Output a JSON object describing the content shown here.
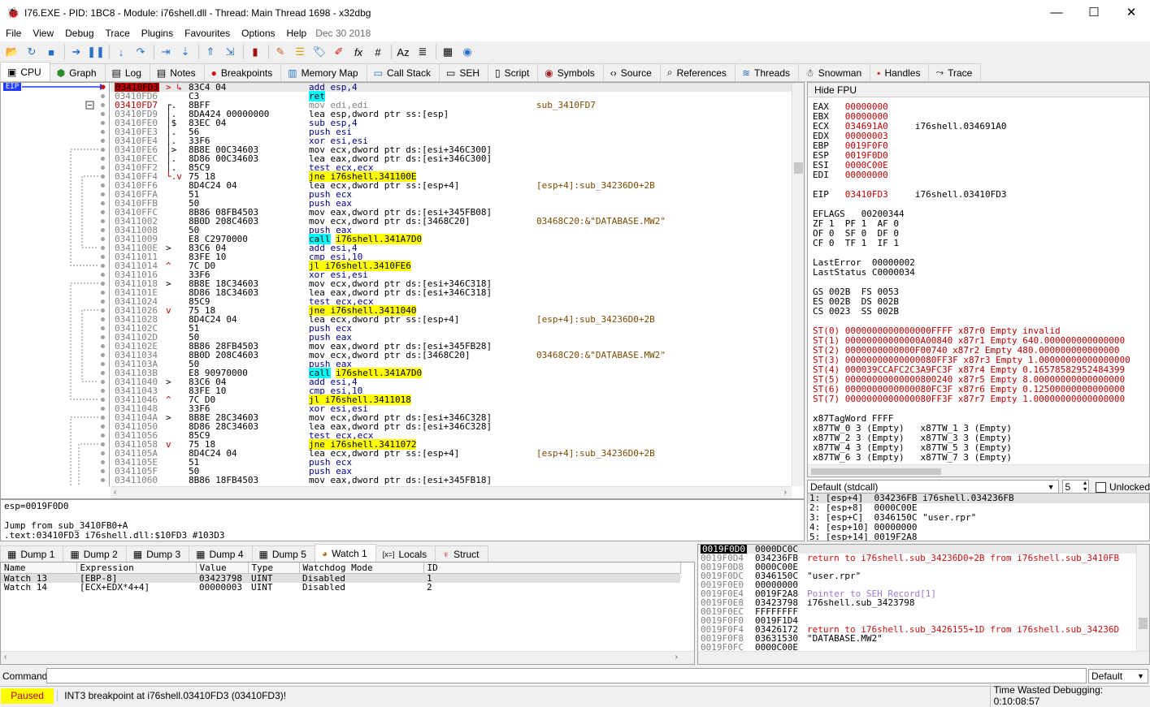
{
  "window": {
    "title": "I76.EXE - PID: 1BC8 - Module: i76shell.dll - Thread: Main Thread 1698 - x32dbg",
    "minimize": "—",
    "maximize": "☐",
    "close": "✕"
  },
  "menu": {
    "items": [
      "File",
      "View",
      "Debug",
      "Trace",
      "Plugins",
      "Favourites",
      "Options",
      "Help"
    ],
    "date": "Dec 30 2018"
  },
  "tabs": [
    "CPU",
    "Graph",
    "Log",
    "Notes",
    "Breakpoints",
    "Memory Map",
    "Call Stack",
    "SEH",
    "Script",
    "Symbols",
    "Source",
    "References",
    "Threads",
    "Snowman",
    "Handles",
    "Trace"
  ],
  "eip_label": "EIP",
  "disasm": [
    {
      "addr": "03410FD3",
      "flow": "> ↳",
      "bytes": "83C4 04",
      "ins": "add esp,4",
      "cmt": "",
      "eip": true
    },
    {
      "addr": "03410FD6",
      "flow": "",
      "bytes": "C3",
      "ins": "ret",
      "cmt": ""
    },
    {
      "addr": "03410FD7",
      "flow": "┌.",
      "bytes": "8BFF",
      "ins": "mov edi,edi",
      "cmt": "sub_3410FD7",
      "red": true
    },
    {
      "addr": "03410FD9",
      "flow": "│.",
      "bytes": "8DA424 00000000",
      "ins": "lea esp,dword ptr ss:[esp]",
      "cmt": ""
    },
    {
      "addr": "03410FE0",
      "flow": "│$",
      "bytes": "83EC 04",
      "ins": "sub esp,4",
      "cmt": ""
    },
    {
      "addr": "03410FE3",
      "flow": "│.",
      "bytes": "56",
      "ins": "push esi",
      "cmt": ""
    },
    {
      "addr": "03410FE4",
      "flow": "│.",
      "bytes": "33F6",
      "ins": "xor esi,esi",
      "cmt": ""
    },
    {
      "addr": "03410FE6",
      "flow": "│>",
      "bytes": "8B8E 00C34603",
      "ins": "mov ecx,dword ptr ds:[esi+346C300]",
      "cmt": ""
    },
    {
      "addr": "03410FEC",
      "flow": "│.",
      "bytes": "8D86 00C34603",
      "ins": "lea eax,dword ptr ds:[esi+346C300]",
      "cmt": ""
    },
    {
      "addr": "03410FF2",
      "flow": "│.",
      "bytes": "85C9",
      "ins": "test ecx,ecx",
      "cmt": ""
    },
    {
      "addr": "03410FF4",
      "flow": "└.v",
      "bytes": "75 18",
      "ins": "jne i76shell.341100E",
      "cmt": ""
    },
    {
      "addr": "03410FF6",
      "flow": "",
      "bytes": "8D4C24 04",
      "ins": "lea ecx,dword ptr ss:[esp+4]",
      "cmt": "[esp+4]:sub_34236D0+2B"
    },
    {
      "addr": "03410FFA",
      "flow": "",
      "bytes": "51",
      "ins": "push ecx",
      "cmt": ""
    },
    {
      "addr": "03410FFB",
      "flow": "",
      "bytes": "50",
      "ins": "push eax",
      "cmt": ""
    },
    {
      "addr": "03410FFC",
      "flow": "",
      "bytes": "8B86 08FB4503",
      "ins": "mov eax,dword ptr ds:[esi+345FB08]",
      "cmt": ""
    },
    {
      "addr": "03411002",
      "flow": "",
      "bytes": "8B0D 208C4603",
      "ins": "mov ecx,dword ptr ds:[3468C20]",
      "cmt": "03468C20:&\"DATABASE.MW2\""
    },
    {
      "addr": "03411008",
      "flow": "",
      "bytes": "50",
      "ins": "push eax",
      "cmt": ""
    },
    {
      "addr": "03411009",
      "flow": "",
      "bytes": "E8 C2970000",
      "ins": "call i76shell.341A7D0",
      "cmt": ""
    },
    {
      "addr": "0341100E",
      "flow": ">",
      "bytes": "83C6 04",
      "ins": "add esi,4",
      "cmt": ""
    },
    {
      "addr": "03411011",
      "flow": "",
      "bytes": "83FE 10",
      "ins": "cmp esi,10",
      "cmt": ""
    },
    {
      "addr": "03411014",
      "flow": "^",
      "bytes": "7C D0",
      "ins": "jl i76shell.3410FE6",
      "cmt": ""
    },
    {
      "addr": "03411016",
      "flow": "",
      "bytes": "33F6",
      "ins": "xor esi,esi",
      "cmt": ""
    },
    {
      "addr": "03411018",
      "flow": ">",
      "bytes": "8B8E 18C34603",
      "ins": "mov ecx,dword ptr ds:[esi+346C318]",
      "cmt": ""
    },
    {
      "addr": "0341101E",
      "flow": "",
      "bytes": "8D86 18C34603",
      "ins": "lea eax,dword ptr ds:[esi+346C318]",
      "cmt": ""
    },
    {
      "addr": "03411024",
      "flow": "",
      "bytes": "85C9",
      "ins": "test ecx,ecx",
      "cmt": ""
    },
    {
      "addr": "03411026",
      "flow": "v",
      "bytes": "75 18",
      "ins": "jne i76shell.3411040",
      "cmt": ""
    },
    {
      "addr": "03411028",
      "flow": "",
      "bytes": "8D4C24 04",
      "ins": "lea ecx,dword ptr ss:[esp+4]",
      "cmt": "[esp+4]:sub_34236D0+2B"
    },
    {
      "addr": "0341102C",
      "flow": "",
      "bytes": "51",
      "ins": "push ecx",
      "cmt": ""
    },
    {
      "addr": "0341102D",
      "flow": "",
      "bytes": "50",
      "ins": "push eax",
      "cmt": ""
    },
    {
      "addr": "0341102E",
      "flow": "",
      "bytes": "8B86 28FB4503",
      "ins": "mov eax,dword ptr ds:[esi+345FB28]",
      "cmt": ""
    },
    {
      "addr": "03411034",
      "flow": "",
      "bytes": "8B0D 208C4603",
      "ins": "mov ecx,dword ptr ds:[3468C20]",
      "cmt": "03468C20:&\"DATABASE.MW2\""
    },
    {
      "addr": "0341103A",
      "flow": "",
      "bytes": "50",
      "ins": "push eax",
      "cmt": ""
    },
    {
      "addr": "0341103B",
      "flow": "",
      "bytes": "E8 90970000",
      "ins": "call i76shell.341A7D0",
      "cmt": ""
    },
    {
      "addr": "03411040",
      "flow": ">",
      "bytes": "83C6 04",
      "ins": "add esi,4",
      "cmt": ""
    },
    {
      "addr": "03411043",
      "flow": "",
      "bytes": "83FE 10",
      "ins": "cmp esi,10",
      "cmt": ""
    },
    {
      "addr": "03411046",
      "flow": "^",
      "bytes": "7C D0",
      "ins": "jl i76shell.3411018",
      "cmt": ""
    },
    {
      "addr": "03411048",
      "flow": "",
      "bytes": "33F6",
      "ins": "xor esi,esi",
      "cmt": ""
    },
    {
      "addr": "0341104A",
      "flow": ">",
      "bytes": "8B8E 28C34603",
      "ins": "mov ecx,dword ptr ds:[esi+346C328]",
      "cmt": ""
    },
    {
      "addr": "03411050",
      "flow": "",
      "bytes": "8D86 28C34603",
      "ins": "lea eax,dword ptr ds:[esi+346C328]",
      "cmt": ""
    },
    {
      "addr": "03411056",
      "flow": "",
      "bytes": "85C9",
      "ins": "test ecx,ecx",
      "cmt": ""
    },
    {
      "addr": "03411058",
      "flow": "v",
      "bytes": "75 18",
      "ins": "jne i76shell.3411072",
      "cmt": ""
    },
    {
      "addr": "0341105A",
      "flow": "",
      "bytes": "8D4C24 04",
      "ins": "lea ecx,dword ptr ss:[esp+4]",
      "cmt": "[esp+4]:sub_34236D0+2B"
    },
    {
      "addr": "0341105E",
      "flow": "",
      "bytes": "51",
      "ins": "push ecx",
      "cmt": ""
    },
    {
      "addr": "0341105F",
      "flow": "",
      "bytes": "50",
      "ins": "push eax",
      "cmt": ""
    },
    {
      "addr": "03411060",
      "flow": "",
      "bytes": "8B86 18FB4503",
      "ins": "mov eax,dword ptr ds:[esi+345FB18]",
      "cmt": ""
    }
  ],
  "registers": {
    "hide_fpu": "Hide FPU",
    "lines": [
      {
        "n": "EAX",
        "v": "00000000",
        "c": ""
      },
      {
        "n": "EBX",
        "v": "00000000",
        "c": ""
      },
      {
        "n": "ECX",
        "v": "034691A0",
        "c": "i76shell.034691A0"
      },
      {
        "n": "EDX",
        "v": "00000003",
        "c": ""
      },
      {
        "n": "EBP",
        "v": "0019F0F0",
        "c": ""
      },
      {
        "n": "ESP",
        "v": "0019F0D0",
        "c": ""
      },
      {
        "n": "ESI",
        "v": "0000C00E",
        "c": ""
      },
      {
        "n": "EDI",
        "v": "00000000",
        "c": ""
      }
    ],
    "eip": {
      "n": "EIP",
      "v": "03410FD3",
      "c": "i76shell.03410FD3"
    },
    "eflags": "EFLAGS   00200344",
    "flags": [
      "ZF 1  PF 1  AF 0",
      "OF 0  SF 0  DF 0",
      "CF 0  TF 1  IF 1"
    ],
    "lasterror": "LastError  00000002",
    "laststatus": "LastStatus C0000034",
    "segs": [
      "GS 002B  FS 0053",
      "ES 002B  DS 002B",
      "CS 0023  SS 002B"
    ],
    "st": [
      "ST(0) 0000000000000000FFFF x87r0 Empty invalid",
      "ST(1) 00000000000000A00840 x87r1 Empty 640.000000000000000",
      "ST(2) 0000000000000F00740 x87r2 Empty 480.000000000000000",
      "ST(3) 00000000000000080FF3F x87r3 Empty 1.00000000000000000",
      "ST(4) 000039CCAFC2C3A9FC3F x87r4 Empty 0.16578582952484399",
      "ST(5) 00000000000000800240 x87r5 Empty 8.00000000000000000",
      "ST(6) 0000000000000080FC3F x87r6 Empty 0.12500000000000000",
      "ST(7) 0000000000000080FF3F x87r7 Empty 1.00000000000000000"
    ],
    "tagword": "x87TagWord FFFF",
    "tw": [
      "x87TW_0 3 (Empty)   x87TW_1 3 (Empty)",
      "x87TW_2 3 (Empty)   x87TW_3 3 (Empty)",
      "x87TW_4 3 (Empty)   x87TW_5 3 (Empty)",
      "x87TW_6 3 (Empty)   x87TW_7 3 (Empty)"
    ]
  },
  "callconv": {
    "value": "Default (stdcall)",
    "count": "5",
    "unlocked": "Unlocked"
  },
  "args": [
    "1: [esp+4]  034236FB i76shell.034236FB",
    "2: [esp+8]  0000C00E",
    "3: [esp+C]  0346150C \"user.rpr\"",
    "4: [esp+10] 00000000",
    "5: [esp+14] 0019F2A8"
  ],
  "info": [
    "esp=0019F0D0",
    "",
    "Jump from sub_3410FB0+A",
    ".text:03410FD3 i76shell.dll:$10FD3 #103D3"
  ],
  "bottom_tabs": [
    "Dump 1",
    "Dump 2",
    "Dump 3",
    "Dump 4",
    "Dump 5",
    "Watch 1",
    "Locals",
    "Struct"
  ],
  "watch": {
    "headers": [
      "Name",
      "Expression",
      "Value",
      "Type",
      "Watchdog Mode",
      "ID"
    ],
    "rows": [
      [
        "Watch 13",
        "[EBP-8]",
        "03423798",
        "UINT",
        "Disabled",
        "1"
      ],
      [
        "Watch 14",
        "[ECX+EDX*4+4]",
        "00000003",
        "UINT",
        "Disabled",
        "2"
      ]
    ]
  },
  "stack": [
    {
      "a": "0019F0D0",
      "v": "0000DC0C",
      "c": "",
      "sel": true
    },
    {
      "a": "0019F0D4",
      "v": "034236FB",
      "c": "return to i76shell.sub_34236D0+2B from i76shell.sub_3410FB",
      "red": true
    },
    {
      "a": "0019F0D8",
      "v": "0000C00E",
      "c": ""
    },
    {
      "a": "0019F0DC",
      "v": "0346150C",
      "c": "\"user.rpr\""
    },
    {
      "a": "0019F0E0",
      "v": "00000000",
      "c": ""
    },
    {
      "a": "0019F0E4",
      "v": "0019F2A8",
      "c": "Pointer to SEH_Record[1]",
      "purple": true
    },
    {
      "a": "0019F0E8",
      "v": "03423798",
      "c": "i76shell.sub_3423798"
    },
    {
      "a": "0019F0EC",
      "v": "FFFFFFFF",
      "c": ""
    },
    {
      "a": "0019F0F0",
      "v": "0019F1D4",
      "c": ""
    },
    {
      "a": "0019F0F4",
      "v": "03426172",
      "c": "return to i76shell.sub_3426155+1D from i76shell.sub_34236D",
      "red": true
    },
    {
      "a": "0019F0F8",
      "v": "03631530",
      "c": "\"DATABASE.MW2\""
    },
    {
      "a": "0019F0FC",
      "v": "0000C00E",
      "c": ""
    }
  ],
  "command": {
    "label": "Command:",
    "value": "",
    "mode": "Default"
  },
  "status": {
    "state": "Paused",
    "message": "INT3 breakpoint at i76shell.03410FD3 (03410FD3)!",
    "time": "Time Wasted Debugging: 0:10:08:57"
  },
  "colors": {
    "accent": "#1f3cff",
    "eip_bg": "#c00000",
    "highlight_yellow": "#ffff00",
    "highlight_cyan": "#00ffff",
    "status_paused": "#ffff00"
  }
}
